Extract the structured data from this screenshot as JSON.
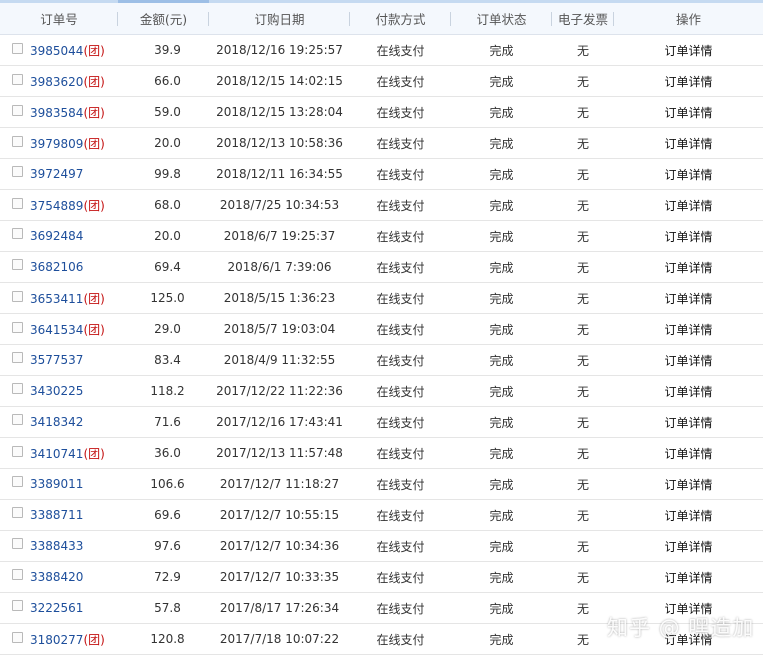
{
  "table": {
    "headers": {
      "order_no": "订单号",
      "amount": "金额(元)",
      "date": "订购日期",
      "payment": "付款方式",
      "status": "订单状态",
      "invoice": "电子发票",
      "action": "操作"
    },
    "rows": [
      {
        "order_id": "3985044",
        "group_tag": "(团)",
        "amount": "39.9",
        "date": "2018/12/16 19:25:57",
        "payment": "在线支付",
        "status": "完成",
        "invoice": "无",
        "action": "订单详情"
      },
      {
        "order_id": "3983620",
        "group_tag": "(团)",
        "amount": "66.0",
        "date": "2018/12/15 14:02:15",
        "payment": "在线支付",
        "status": "完成",
        "invoice": "无",
        "action": "订单详情"
      },
      {
        "order_id": "3983584",
        "group_tag": "(团)",
        "amount": "59.0",
        "date": "2018/12/15 13:28:04",
        "payment": "在线支付",
        "status": "完成",
        "invoice": "无",
        "action": "订单详情"
      },
      {
        "order_id": "3979809",
        "group_tag": "(团)",
        "amount": "20.0",
        "date": "2018/12/13 10:58:36",
        "payment": "在线支付",
        "status": "完成",
        "invoice": "无",
        "action": "订单详情"
      },
      {
        "order_id": "3972497",
        "group_tag": "",
        "amount": "99.8",
        "date": "2018/12/11 16:34:55",
        "payment": "在线支付",
        "status": "完成",
        "invoice": "无",
        "action": "订单详情"
      },
      {
        "order_id": "3754889",
        "group_tag": "(团)",
        "amount": "68.0",
        "date": "2018/7/25 10:34:53",
        "payment": "在线支付",
        "status": "完成",
        "invoice": "无",
        "action": "订单详情"
      },
      {
        "order_id": "3692484",
        "group_tag": "",
        "amount": "20.0",
        "date": "2018/6/7 19:25:37",
        "payment": "在线支付",
        "status": "完成",
        "invoice": "无",
        "action": "订单详情"
      },
      {
        "order_id": "3682106",
        "group_tag": "",
        "amount": "69.4",
        "date": "2018/6/1 7:39:06",
        "payment": "在线支付",
        "status": "完成",
        "invoice": "无",
        "action": "订单详情"
      },
      {
        "order_id": "3653411",
        "group_tag": "(团)",
        "amount": "125.0",
        "date": "2018/5/15 1:36:23",
        "payment": "在线支付",
        "status": "完成",
        "invoice": "无",
        "action": "订单详情"
      },
      {
        "order_id": "3641534",
        "group_tag": "(团)",
        "amount": "29.0",
        "date": "2018/5/7 19:03:04",
        "payment": "在线支付",
        "status": "完成",
        "invoice": "无",
        "action": "订单详情"
      },
      {
        "order_id": "3577537",
        "group_tag": "",
        "amount": "83.4",
        "date": "2018/4/9 11:32:55",
        "payment": "在线支付",
        "status": "完成",
        "invoice": "无",
        "action": "订单详情"
      },
      {
        "order_id": "3430225",
        "group_tag": "",
        "amount": "118.2",
        "date": "2017/12/22 11:22:36",
        "payment": "在线支付",
        "status": "完成",
        "invoice": "无",
        "action": "订单详情"
      },
      {
        "order_id": "3418342",
        "group_tag": "",
        "amount": "71.6",
        "date": "2017/12/16 17:43:41",
        "payment": "在线支付",
        "status": "完成",
        "invoice": "无",
        "action": "订单详情"
      },
      {
        "order_id": "3410741",
        "group_tag": "(团)",
        "amount": "36.0",
        "date": "2017/12/13 11:57:48",
        "payment": "在线支付",
        "status": "完成",
        "invoice": "无",
        "action": "订单详情"
      },
      {
        "order_id": "3389011",
        "group_tag": "",
        "amount": "106.6",
        "date": "2017/12/7 11:18:27",
        "payment": "在线支付",
        "status": "完成",
        "invoice": "无",
        "action": "订单详情"
      },
      {
        "order_id": "3388711",
        "group_tag": "",
        "amount": "69.6",
        "date": "2017/12/7 10:55:15",
        "payment": "在线支付",
        "status": "完成",
        "invoice": "无",
        "action": "订单详情"
      },
      {
        "order_id": "3388433",
        "group_tag": "",
        "amount": "97.6",
        "date": "2017/12/7 10:34:36",
        "payment": "在线支付",
        "status": "完成",
        "invoice": "无",
        "action": "订单详情"
      },
      {
        "order_id": "3388420",
        "group_tag": "",
        "amount": "72.9",
        "date": "2017/12/7 10:33:35",
        "payment": "在线支付",
        "status": "完成",
        "invoice": "无",
        "action": "订单详情"
      },
      {
        "order_id": "3222561",
        "group_tag": "",
        "amount": "57.8",
        "date": "2017/8/17 17:26:34",
        "payment": "在线支付",
        "status": "完成",
        "invoice": "无",
        "action": "订单详情"
      },
      {
        "order_id": "3180277",
        "group_tag": "(团)",
        "amount": "120.8",
        "date": "2017/7/18 10:07:22",
        "payment": "在线支付",
        "status": "完成",
        "invoice": "无",
        "action": "订单详情"
      }
    ]
  },
  "watermark": "知乎 @ 嘿造加",
  "colors": {
    "order_link": "#1d4e9b",
    "group_tag": "#c41212",
    "header_bg": "#f4f8fd",
    "header_accent": "#9dbfe6"
  }
}
